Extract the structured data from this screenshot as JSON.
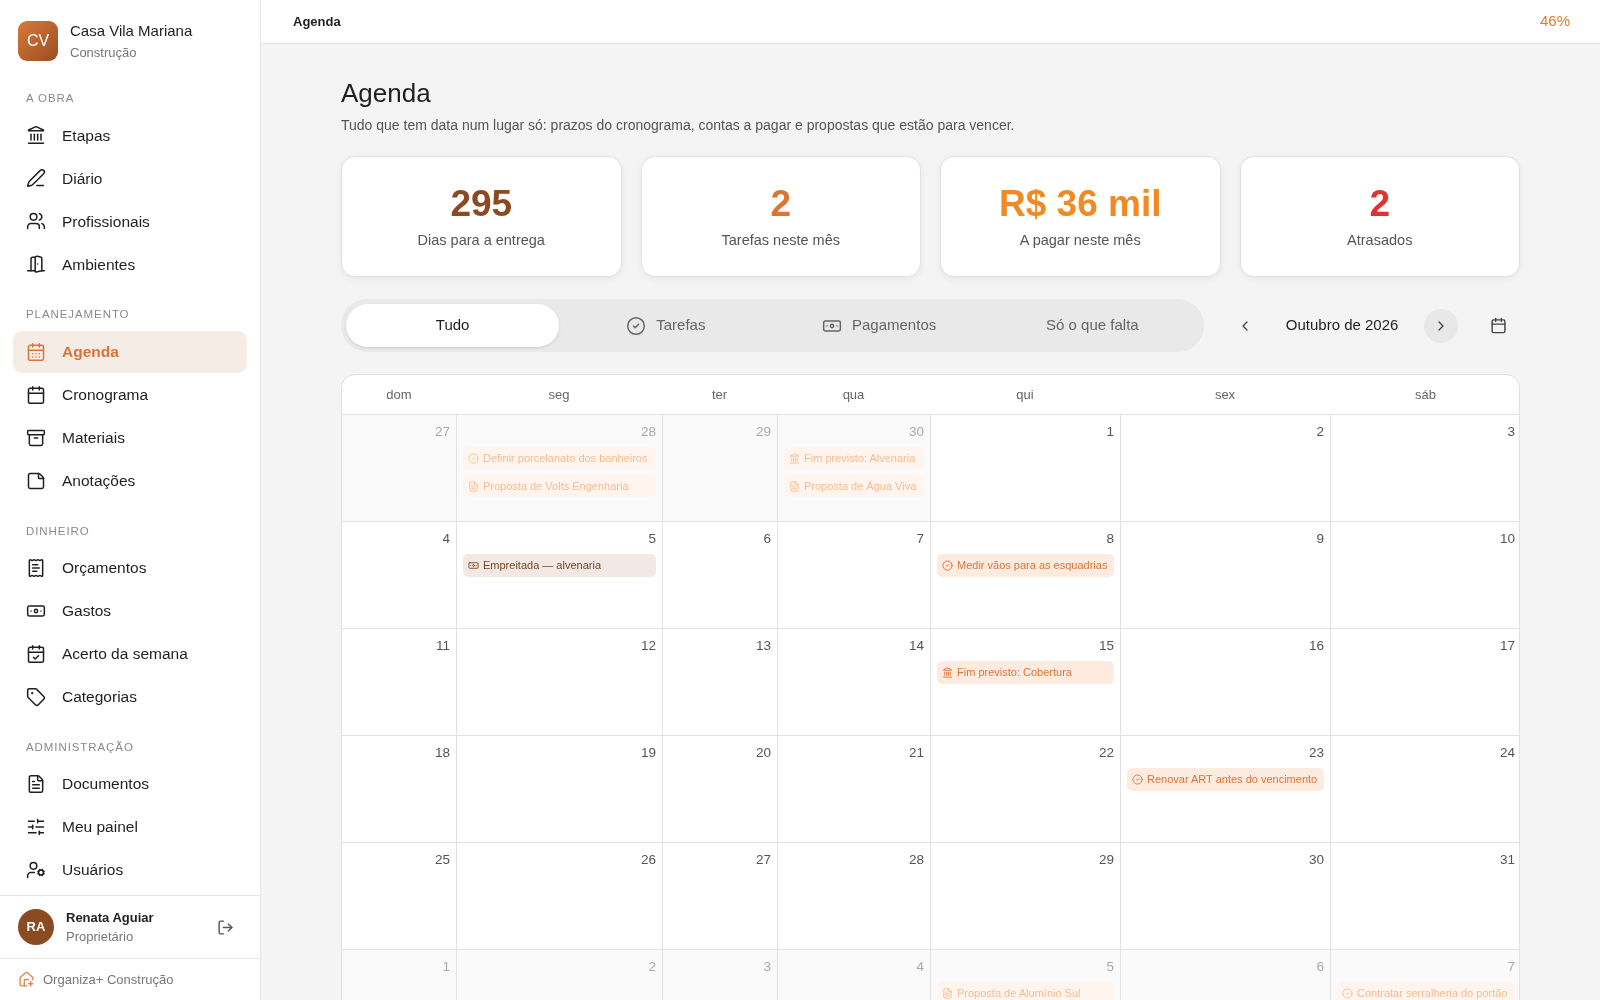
{
  "project": {
    "initials": "CV",
    "name": "Casa Vila Mariana",
    "subtitle": "Construção"
  },
  "sidebar": {
    "sections": [
      {
        "title": "A OBRA",
        "items": [
          {
            "label": "Etapas",
            "selected": false
          },
          {
            "label": "Diário",
            "selected": false
          },
          {
            "label": "Profissionais",
            "selected": false
          },
          {
            "label": "Ambientes",
            "selected": false
          }
        ]
      },
      {
        "title": "PLANEJAMENTO",
        "items": [
          {
            "label": "Agenda",
            "selected": true
          },
          {
            "label": "Cronograma",
            "selected": false
          },
          {
            "label": "Materiais",
            "selected": false
          },
          {
            "label": "Anotações",
            "selected": false
          }
        ]
      },
      {
        "title": "DINHEIRO",
        "items": [
          {
            "label": "Orçamentos",
            "selected": false
          },
          {
            "label": "Gastos",
            "selected": false
          },
          {
            "label": "Acerto da semana",
            "selected": false
          },
          {
            "label": "Categorias",
            "selected": false
          }
        ]
      },
      {
        "title": "ADMINISTRAÇÃO",
        "items": [
          {
            "label": "Documentos",
            "selected": false
          },
          {
            "label": "Meu painel",
            "selected": false
          },
          {
            "label": "Usuários",
            "selected": false
          }
        ]
      }
    ]
  },
  "user": {
    "initials": "RA",
    "name": "Renata Aguiar",
    "role": "Proprietário"
  },
  "footer": "Organiza+ Construção",
  "topbar": {
    "title": "Agenda",
    "progress": "46%"
  },
  "page": {
    "title": "Agenda",
    "subtitle": "Tudo que tem data num lugar só: prazos do cronograma, contas a pagar e propostas que estão para vencer."
  },
  "stats": [
    {
      "value": "295",
      "label": "Dias para a entrega",
      "color": "#8a4a22"
    },
    {
      "value": "2",
      "label": "Tarefas neste mês",
      "color": "#dc7533"
    },
    {
      "value": "R$ 36 mil",
      "label": "A pagar neste mês",
      "color": "#f08a24"
    },
    {
      "value": "2",
      "label": "Atrasados",
      "color": "#e0322f"
    }
  ],
  "filters": [
    {
      "label": "Tudo",
      "kind": "all",
      "selected": true
    },
    {
      "label": "Tarefas",
      "kind": "tasks",
      "selected": false
    },
    {
      "label": "Pagamentos",
      "kind": "payments",
      "selected": false
    },
    {
      "label": "Só o que falta",
      "kind": "pending",
      "selected": false
    }
  ],
  "month": "Outubro de 2026",
  "weekdays": [
    "dom",
    "seg",
    "ter",
    "qua",
    "qui",
    "sex",
    "sáb"
  ],
  "weeks": [
    [
      {
        "day": "27",
        "outside": true
      },
      {
        "day": "28",
        "outside": true,
        "events": [
          {
            "kind": "task",
            "text": "Definir porcelanato dos banheiros"
          },
          {
            "kind": "proposal",
            "text": "Proposta de Volts Engenharia"
          }
        ]
      },
      {
        "day": "29",
        "outside": true
      },
      {
        "day": "30",
        "outside": true,
        "events": [
          {
            "kind": "stage",
            "text": "Fim previsto: Alvenaria"
          },
          {
            "kind": "proposal",
            "text": "Proposta de Água Viva"
          }
        ]
      },
      {
        "day": "1",
        "outside": false
      },
      {
        "day": "2",
        "outside": false
      },
      {
        "day": "3",
        "outside": false
      }
    ],
    [
      {
        "day": "4",
        "outside": false
      },
      {
        "day": "5",
        "outside": false,
        "events": [
          {
            "kind": "payment",
            "text": "Empreitada — alvenaria"
          }
        ]
      },
      {
        "day": "6",
        "outside": false
      },
      {
        "day": "7",
        "outside": false
      },
      {
        "day": "8",
        "outside": false,
        "events": [
          {
            "kind": "task",
            "text": "Medir vãos para as esquadrias"
          }
        ]
      },
      {
        "day": "9",
        "outside": false
      },
      {
        "day": "10",
        "outside": false
      }
    ],
    [
      {
        "day": "11",
        "outside": false
      },
      {
        "day": "12",
        "outside": false
      },
      {
        "day": "13",
        "outside": false
      },
      {
        "day": "14",
        "outside": false
      },
      {
        "day": "15",
        "outside": false,
        "events": [
          {
            "kind": "stage",
            "text": "Fim previsto: Cobertura"
          }
        ]
      },
      {
        "day": "16",
        "outside": false
      },
      {
        "day": "17",
        "outside": false
      }
    ],
    [
      {
        "day": "18",
        "outside": false
      },
      {
        "day": "19",
        "outside": false
      },
      {
        "day": "20",
        "outside": false
      },
      {
        "day": "21",
        "outside": false
      },
      {
        "day": "22",
        "outside": false
      },
      {
        "day": "23",
        "outside": false,
        "events": [
          {
            "kind": "task",
            "text": "Renovar ART antes do vencimento"
          }
        ]
      },
      {
        "day": "24",
        "outside": false
      }
    ],
    [
      {
        "day": "25",
        "outside": false
      },
      {
        "day": "26",
        "outside": false
      },
      {
        "day": "27",
        "outside": false
      },
      {
        "day": "28",
        "outside": false
      },
      {
        "day": "29",
        "outside": false
      },
      {
        "day": "30",
        "outside": false
      },
      {
        "day": "31",
        "outside": false
      }
    ],
    [
      {
        "day": "1",
        "outside": true
      },
      {
        "day": "2",
        "outside": true
      },
      {
        "day": "3",
        "outside": true
      },
      {
        "day": "4",
        "outside": true
      },
      {
        "day": "5",
        "outside": true,
        "events": [
          {
            "kind": "proposal",
            "text": "Proposta de Alumínio Sul"
          }
        ]
      },
      {
        "day": "6",
        "outside": true
      },
      {
        "day": "7",
        "outside": true,
        "events": [
          {
            "kind": "task",
            "text": "Contratar serralheria do portão"
          }
        ]
      }
    ]
  ]
}
